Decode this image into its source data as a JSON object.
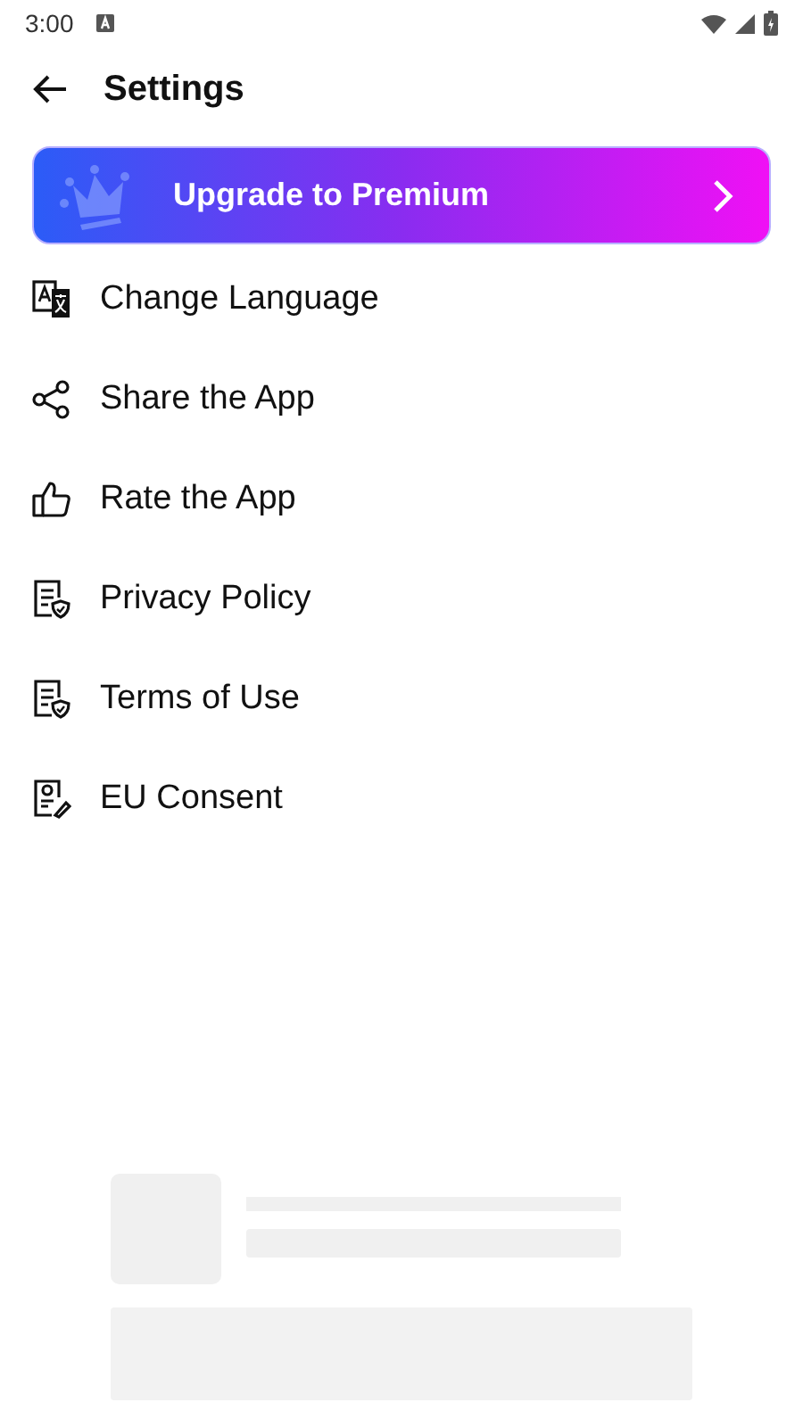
{
  "status_bar": {
    "time": "3:00"
  },
  "header": {
    "title": "Settings"
  },
  "premium_banner": {
    "label": "Upgrade to Premium"
  },
  "menu_items": [
    {
      "label": "Change Language",
      "kind": "language"
    },
    {
      "label": "Share the App",
      "kind": "share"
    },
    {
      "label": "Rate the App",
      "kind": "rate"
    },
    {
      "label": "Privacy Policy",
      "kind": "document"
    },
    {
      "label": "Terms of Use",
      "kind": "document"
    },
    {
      "label": "EU Consent",
      "kind": "consent"
    }
  ],
  "ad_placeholder": {
    "kind": "loading"
  }
}
